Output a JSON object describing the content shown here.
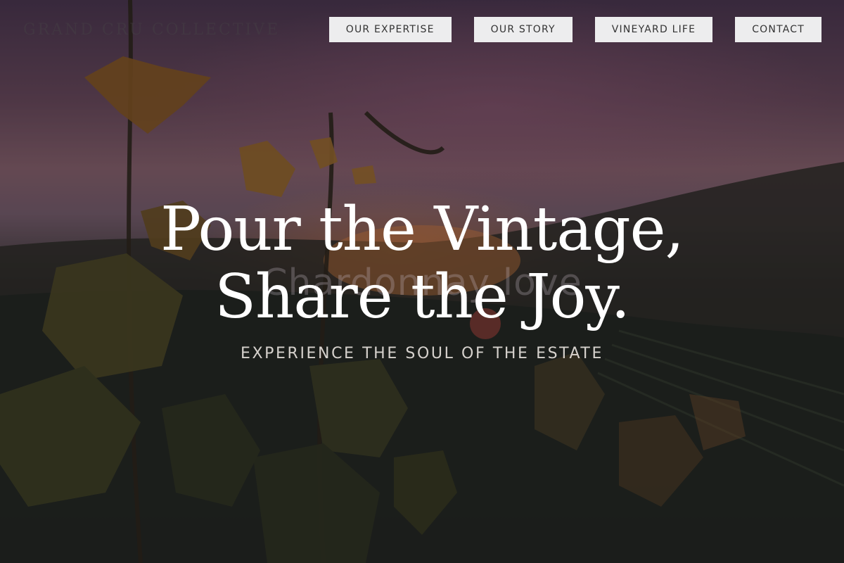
{
  "brand": {
    "name": "GRAND CRU COLLECTIVE"
  },
  "nav": {
    "items": [
      {
        "label": "OUR EXPERTISE"
      },
      {
        "label": "OUR STORY"
      },
      {
        "label": "VINEYARD LIFE"
      },
      {
        "label": "CONTACT"
      }
    ]
  },
  "hero": {
    "headline_line1": "Pour the Vintage,",
    "headline_line2": "Share the Joy.",
    "ghost_text": "Chardonnay love",
    "subhead": "EXPERIENCE THE SOUL OF THE ESTATE",
    "background": {
      "description_icon": "vineyard-sunset-image",
      "accent_colors": [
        "#4a3550",
        "#8b6470",
        "#dc783c",
        "#1d211b"
      ]
    }
  }
}
